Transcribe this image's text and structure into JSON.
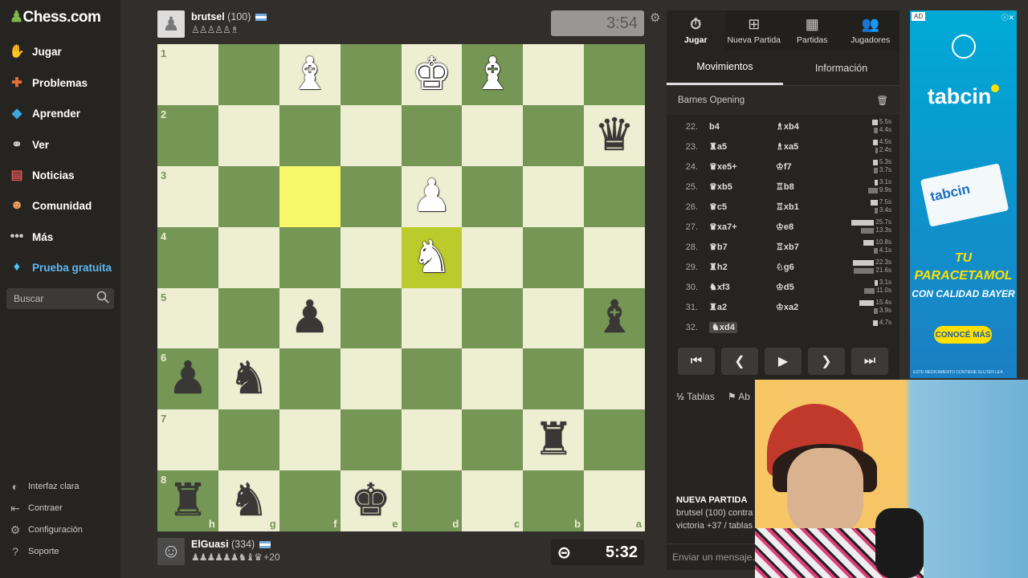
{
  "brand": {
    "logo": "Chess.com"
  },
  "sidebar": {
    "items": [
      {
        "label": "Jugar"
      },
      {
        "label": "Problemas"
      },
      {
        "label": "Aprender"
      },
      {
        "label": "Ver"
      },
      {
        "label": "Noticias"
      },
      {
        "label": "Comunidad"
      },
      {
        "label": "Más"
      },
      {
        "label": "Prueba gratuita"
      }
    ],
    "search_placeholder": "Buscar",
    "footer": [
      {
        "label": "Interfaz clara"
      },
      {
        "label": "Contraer"
      },
      {
        "label": "Configuración"
      },
      {
        "label": "Soporte"
      }
    ]
  },
  "top_player": {
    "name": "brutsel",
    "rating": "(100)",
    "captured": "♙♙♙♙♙♗",
    "clock": "3:54"
  },
  "bottom_player": {
    "name": "ElGuasi",
    "rating": "(334)",
    "captured": "♟♟♟♟♟♟♞♝♛",
    "advantage": "+20",
    "clock": "5:32"
  },
  "board": {
    "ranks": [
      "1",
      "2",
      "3",
      "4",
      "5",
      "6",
      "7",
      "8"
    ],
    "files": [
      "h",
      "g",
      "f",
      "e",
      "d",
      "c",
      "b",
      "a"
    ],
    "highlights": [
      "f3",
      "d4"
    ],
    "pieces": {
      "f1": "♝",
      "d1": "♚",
      "c1": "♝",
      "a2": "♛",
      "d3": "♟",
      "d4": "♞",
      "f5": "♟",
      "a5": "♝",
      "h6": "♟",
      "g6": "♞",
      "b7": "♜",
      "h8": "♜",
      "g8": "♞",
      "e8": "♚"
    },
    "piece_colors": {
      "f1": "w",
      "d1": "w",
      "c1": "w",
      "d3": "w",
      "d4": "w",
      "a2": "b",
      "f5": "b",
      "a5": "b",
      "h6": "b",
      "g6": "b",
      "b7": "b",
      "h8": "b",
      "g8": "b",
      "e8": "b"
    }
  },
  "panel": {
    "topnav": [
      {
        "label": "Jugar",
        "icon": "stopwatch-icon"
      },
      {
        "label": "Nueva Partida",
        "icon": "plus-icon"
      },
      {
        "label": "Partidas",
        "icon": "board-icon"
      },
      {
        "label": "Jugadores",
        "icon": "users-icon"
      }
    ],
    "tabs": [
      {
        "label": "Movimientos"
      },
      {
        "label": "Información"
      }
    ],
    "opening": "Barnes Opening",
    "moves": [
      {
        "n": "22.",
        "w": "b4",
        "b": "♗xb4",
        "tw": "5.5s",
        "tb": "4.4s"
      },
      {
        "n": "23.",
        "w": "♜a5",
        "b": "♗xa5",
        "tw": "4.5s",
        "tb": "2.4s"
      },
      {
        "n": "24.",
        "w": "♛xe5+",
        "b": "♔f7",
        "tw": "5.3s",
        "tb": "3.7s"
      },
      {
        "n": "25.",
        "w": "♛xb5",
        "b": "♖b8",
        "tw": "3.1s",
        "tb": "9.9s"
      },
      {
        "n": "26.",
        "w": "♛c5",
        "b": "♖xb1",
        "tw": "7.5s",
        "tb": "3.4s"
      },
      {
        "n": "27.",
        "w": "♛xa7+",
        "b": "♔e8",
        "tw": "25.7s",
        "tb": "13.3s"
      },
      {
        "n": "28.",
        "w": "♛b7",
        "b": "♖xb7",
        "tw": "10.8s",
        "tb": "4.1s"
      },
      {
        "n": "29.",
        "w": "♜h2",
        "b": "♘g6",
        "tw": "22.3s",
        "tb": "21.6s"
      },
      {
        "n": "30.",
        "w": "♞xf3",
        "b": "♔d5",
        "tw": "3.1s",
        "tb": "11.0s"
      },
      {
        "n": "31.",
        "w": "♜a2",
        "b": "♔xa2",
        "tw": "15.4s",
        "tb": "3.9s"
      },
      {
        "n": "32.",
        "w": "♞xd4",
        "b": "",
        "tw": "4.7s",
        "tb": ""
      }
    ],
    "actions": [
      {
        "label": "Tablas"
      },
      {
        "label": "Ab"
      }
    ],
    "news_title": "NUEVA PARTIDA",
    "news_line1": "brutsel (100) contra",
    "news_line2": "victoria +37 / tablas",
    "chat_placeholder": "Enviar un mensaje..."
  },
  "ad": {
    "tag": "AD",
    "brand": "tabcin",
    "box_text": "tabcin",
    "slogan1": "TU PARACETAMOL",
    "slogan2": "CON CALIDAD BAYER",
    "cta": "CONOCÉ MÁS",
    "disclaimer": "ESTE MEDICAMENTO CONTIENE GLUTEN LEA"
  }
}
